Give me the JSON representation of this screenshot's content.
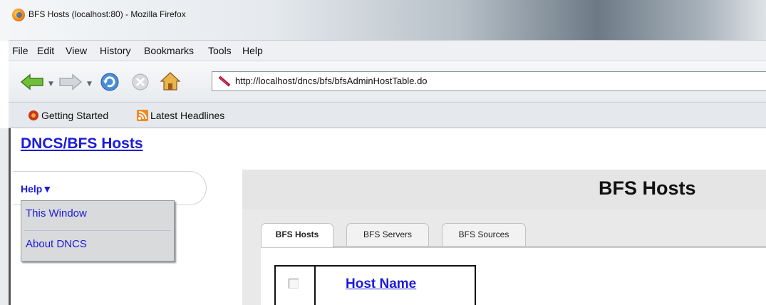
{
  "window": {
    "title": "BFS Hosts (localhost:80) - Mozilla Firefox"
  },
  "menubar": {
    "items": [
      {
        "label": "File"
      },
      {
        "label": "Edit"
      },
      {
        "label": "View"
      },
      {
        "label": "History"
      },
      {
        "label": "Bookmarks"
      },
      {
        "label": "Tools"
      },
      {
        "label": "Help"
      }
    ]
  },
  "navbar": {
    "icons": [
      "back-arrow-icon",
      "forward-arrow-icon",
      "reload-icon",
      "stop-icon",
      "home-icon",
      "feather-icon"
    ],
    "url": "http://localhost/dncs/bfs/bfsAdminHostTable.do"
  },
  "bookmarks": [
    {
      "label": "Getting Started",
      "icon": "firefox-bookmark-icon"
    },
    {
      "label": "Latest Headlines",
      "icon": "rss-feed-icon"
    }
  ],
  "page": {
    "breadcrumb": {
      "root": "DNCS",
      "sep": "/",
      "current": "BFS Hosts"
    },
    "help": {
      "label": "Help▼",
      "menu": [
        {
          "label": "This Window"
        },
        {
          "label": "About DNCS"
        }
      ]
    },
    "panel_title": "BFS Hosts",
    "tabs": [
      {
        "label": "BFS Hosts",
        "active": true
      },
      {
        "label": "BFS Servers",
        "active": false
      },
      {
        "label": "BFS Sources",
        "active": false
      }
    ],
    "table": {
      "header": "Host Name"
    }
  },
  "colors": {
    "link": "#1b1bd8",
    "panel": "#e5e5e6"
  }
}
